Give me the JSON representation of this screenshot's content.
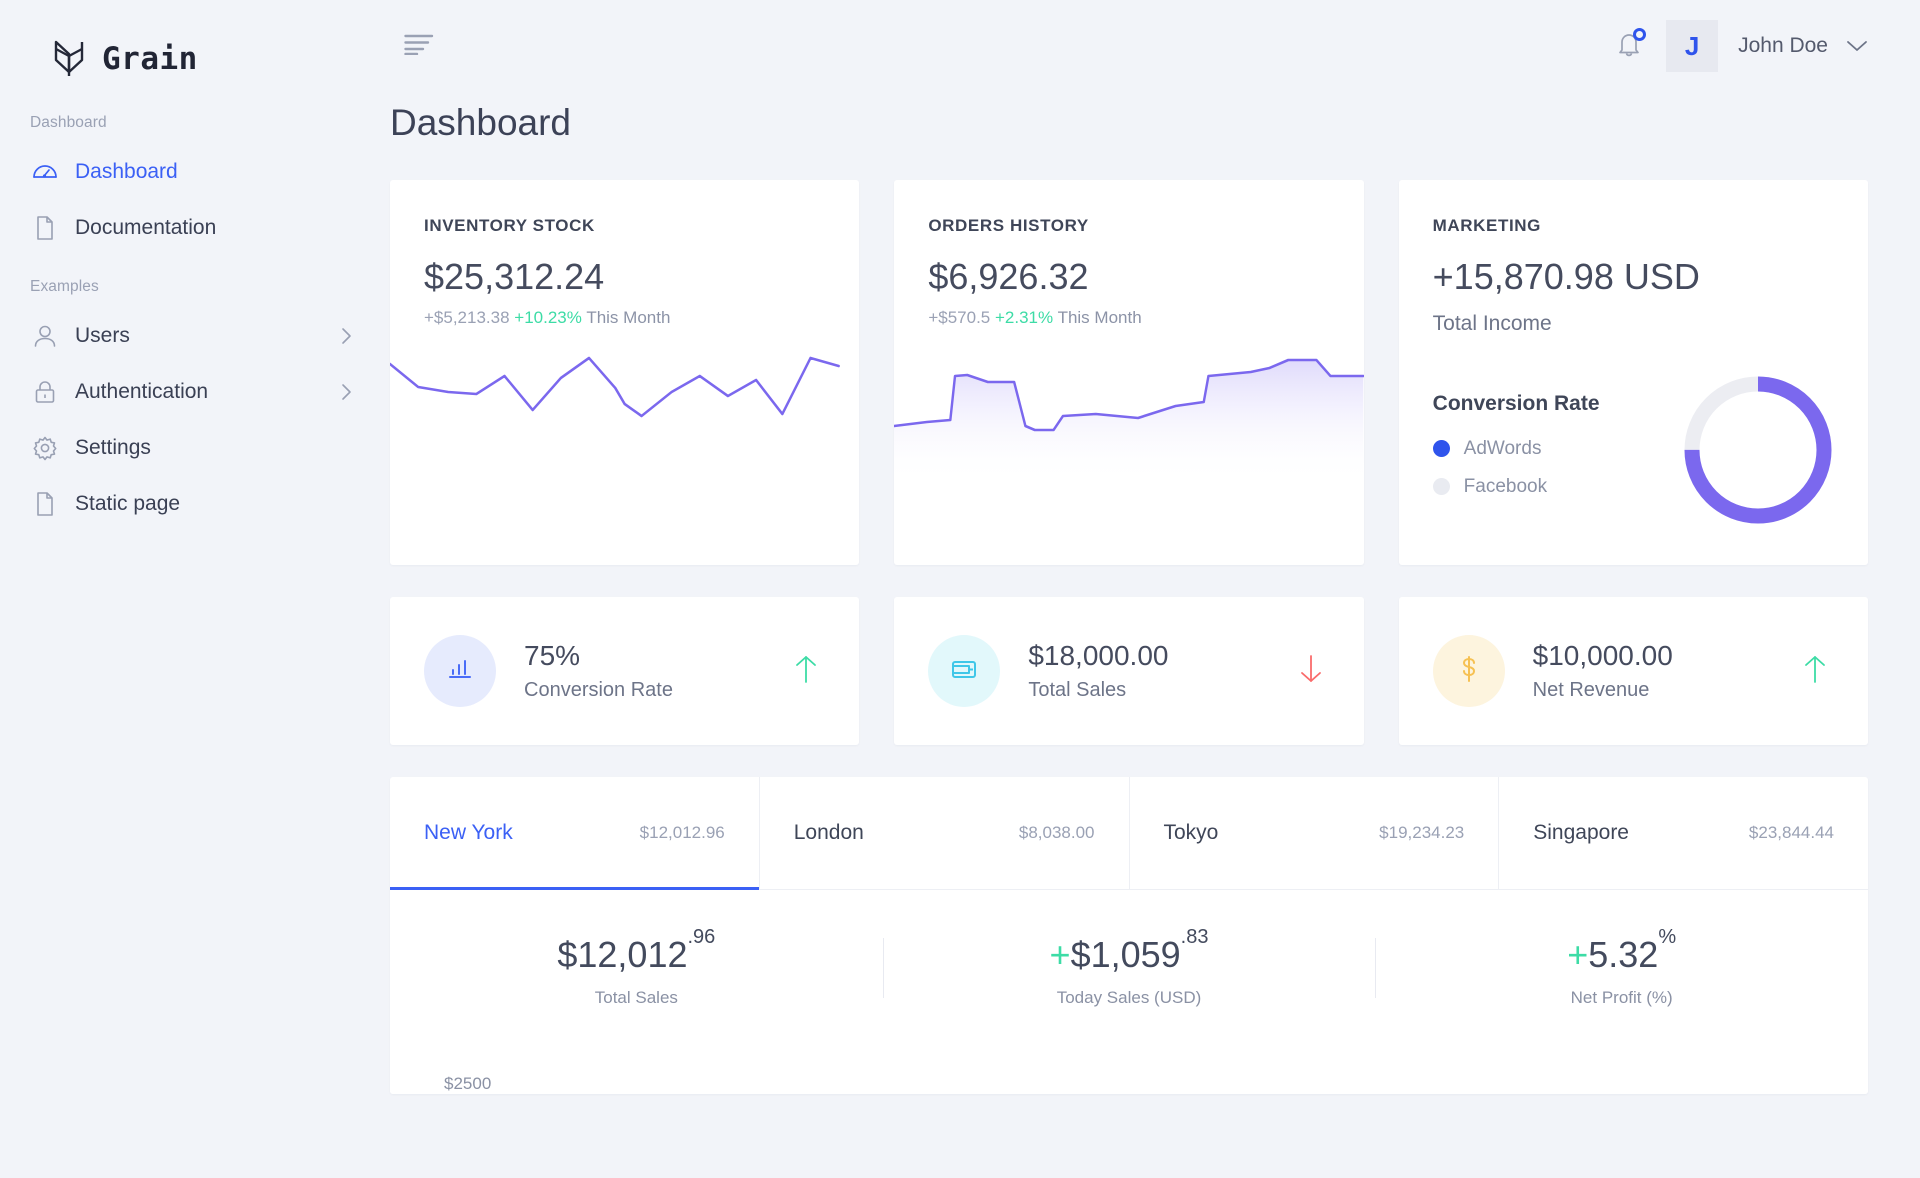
{
  "brand": {
    "name": "Grain",
    "logo_icon": "grain-logo-icon"
  },
  "sidebar": {
    "sections": [
      {
        "label": "Dashboard",
        "items": [
          {
            "label": "Dashboard",
            "icon": "speedometer-icon",
            "active": true,
            "expandable": false
          },
          {
            "label": "Documentation",
            "icon": "file-icon",
            "active": false,
            "expandable": false
          }
        ]
      },
      {
        "label": "Examples",
        "items": [
          {
            "label": "Users",
            "icon": "user-icon",
            "active": false,
            "expandable": true
          },
          {
            "label": "Authentication",
            "icon": "lock-icon",
            "active": false,
            "expandable": true
          },
          {
            "label": "Settings",
            "icon": "gear-icon",
            "active": false,
            "expandable": false
          },
          {
            "label": "Static page",
            "icon": "file-icon",
            "active": false,
            "expandable": false
          }
        ]
      }
    ]
  },
  "topbar": {
    "menu_icon": "hamburger-menu-icon",
    "bell_icon": "bell-icon",
    "has_notification": true,
    "avatar_initial": "J",
    "user_name": "John Doe",
    "chevron_icon": "chevron-down-icon"
  },
  "page": {
    "title": "Dashboard"
  },
  "cards": {
    "inventory": {
      "title": "INVENTORY STOCK",
      "value": "$25,312.24",
      "delta": "+$5,213.38",
      "percent": "+10.23%",
      "period": "This Month"
    },
    "orders": {
      "title": "ORDERS HISTORY",
      "value": "$6,926.32",
      "delta": "+$570.5",
      "percent": "+2.31%",
      "period": "This Month"
    },
    "marketing": {
      "title": "MARKETING",
      "income": "+15,870.98 USD",
      "income_label": "Total Income",
      "conversion_heading": "Conversion Rate",
      "legend": [
        {
          "label": "AdWords",
          "color": "#2f54ec"
        },
        {
          "label": "Facebook",
          "color": "#e9ebf1"
        }
      ]
    }
  },
  "stats": [
    {
      "value": "75%",
      "label": "Conversion Rate",
      "icon": "bar-chart-icon",
      "circle_color": "#e6ebfd",
      "icon_color": "#4a6cf7",
      "trend": "up",
      "trend_color": "#3ddca6"
    },
    {
      "value": "$18,000.00",
      "label": "Total Sales",
      "icon": "wallet-icon",
      "circle_color": "#e2f8fb",
      "icon_color": "#3fc7e8",
      "trend": "down",
      "trend_color": "#fa6b6b"
    },
    {
      "value": "$10,000.00",
      "label": "Net Revenue",
      "icon": "dollar-icon",
      "circle_color": "#fdf4de",
      "icon_color": "#f6c153",
      "trend": "up",
      "trend_color": "#3ddca6"
    }
  ],
  "city_tabs": [
    {
      "name": "New York",
      "amount": "$12,012.96",
      "active": true
    },
    {
      "name": "London",
      "amount": "$8,038.00",
      "active": false
    },
    {
      "name": "Tokyo",
      "amount": "$19,234.23",
      "active": false
    },
    {
      "name": "Singapore",
      "amount": "$23,844.44",
      "active": false
    }
  ],
  "kpis": [
    {
      "prefix": "",
      "main": "$12,012",
      "sup": ".96",
      "label": "Total Sales"
    },
    {
      "prefix": "+",
      "main": "$1,059",
      "sup": ".83",
      "label": "Today Sales (USD)"
    },
    {
      "prefix": "+",
      "main": "5.32",
      "sup": "%",
      "label": "Net Profit (%)"
    }
  ],
  "bottom_chart": {
    "y_tick": "$2500"
  },
  "chart_data": [
    {
      "type": "line",
      "title": "INVENTORY STOCK",
      "series": [
        {
          "name": "Inventory Stock",
          "values": [
            72,
            52,
            47,
            45,
            62,
            32,
            54,
            76,
            48,
            28,
            53,
            64,
            44,
            60,
            40,
            26,
            75,
            68
          ]
        }
      ],
      "x": [
        1,
        2,
        3,
        4,
        5,
        6,
        7,
        8,
        9,
        10,
        11,
        12,
        13,
        14,
        15,
        16,
        17,
        18
      ],
      "color": "#7b68ee",
      "grid": false,
      "legend": "none",
      "ylim": [
        0,
        100
      ],
      "xlabel": "",
      "ylabel": ""
    },
    {
      "type": "area",
      "title": "ORDERS HISTORY",
      "series": [
        {
          "name": "Orders History",
          "values": [
            31,
            33,
            34,
            62,
            56,
            56,
            55,
            20,
            20,
            34,
            35,
            34,
            34,
            38,
            45,
            45,
            63,
            68,
            70,
            76,
            76,
            68,
            68
          ]
        }
      ],
      "x": [
        1,
        2,
        3,
        4,
        5,
        6,
        7,
        8,
        9,
        10,
        11,
        12,
        13,
        14,
        15,
        16,
        17,
        18,
        19,
        20,
        21,
        22,
        23
      ],
      "color": "#7b68ee",
      "fill": "#ece9fd",
      "grid": false,
      "legend": "none",
      "ylim": [
        0,
        100
      ],
      "xlabel": "",
      "ylabel": ""
    },
    {
      "type": "pie",
      "title": "Conversion Rate",
      "labels": [
        "AdWords",
        "Facebook"
      ],
      "values": [
        75,
        25
      ],
      "colors": [
        "#7b68ee",
        "#e9ebf1"
      ],
      "legend": "left",
      "donut": true
    }
  ]
}
